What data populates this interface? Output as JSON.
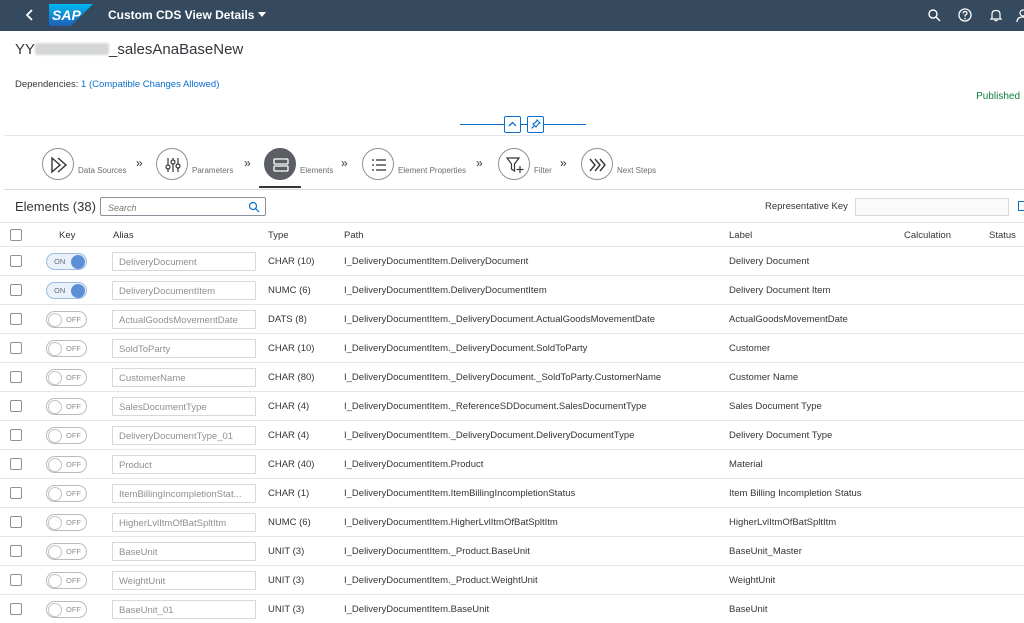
{
  "shell": {
    "title": "Custom CDS View Details",
    "logo_text": "SAP",
    "icons": [
      "back-icon",
      "search-icon",
      "help-icon",
      "notifications-icon",
      "user-menu-icon"
    ]
  },
  "header": {
    "object_title_prefix": "YY",
    "object_title_suffix": "_salesAnaBaseNew",
    "dependencies_label": "Dependencies:",
    "dependencies_link": "1 (Compatible Changes Allowed)",
    "status": "Published"
  },
  "wizard": {
    "active_step": 2,
    "steps": [
      {
        "label": "Data Sources",
        "icon": "data-sources-icon"
      },
      {
        "label": "Parameters",
        "icon": "parameters-icon"
      },
      {
        "label": "Elements",
        "icon": "elements-icon"
      },
      {
        "label": "Element Properties",
        "icon": "element-properties-icon"
      },
      {
        "label": "Filter",
        "icon": "filter-icon"
      },
      {
        "label": "Next Steps",
        "icon": "next-steps-icon"
      }
    ]
  },
  "toolbar": {
    "elements_count": "Elements (38)",
    "search_placeholder": "Search",
    "representative_key_label": "Representative Key",
    "representative_key_value": ""
  },
  "table": {
    "columns": {
      "key": "Key",
      "alias": "Alias",
      "type": "Type",
      "path": "Path",
      "label": "Label",
      "calculation": "Calculation",
      "status": "Status"
    },
    "toggle_on": "ON",
    "toggle_off": "OFF",
    "rows": [
      {
        "key": true,
        "alias": "DeliveryDocument",
        "type": "CHAR (10)",
        "path": "I_DeliveryDocumentItem.DeliveryDocument",
        "label": "Delivery Document"
      },
      {
        "key": true,
        "alias": "DeliveryDocumentItem",
        "type": "NUMC (6)",
        "path": "I_DeliveryDocumentItem.DeliveryDocumentItem",
        "label": "Delivery Document Item"
      },
      {
        "key": false,
        "alias": "ActualGoodsMovementDate",
        "type": "DATS (8)",
        "path": "I_DeliveryDocumentItem._DeliveryDocument.ActualGoodsMovementDate",
        "label": "ActualGoodsMovementDate"
      },
      {
        "key": false,
        "alias": "SoldToParty",
        "type": "CHAR (10)",
        "path": "I_DeliveryDocumentItem._DeliveryDocument.SoldToParty",
        "label": "Customer"
      },
      {
        "key": false,
        "alias": "CustomerName",
        "type": "CHAR (80)",
        "path": "I_DeliveryDocumentItem._DeliveryDocument._SoldToParty.CustomerName",
        "label": "Customer Name"
      },
      {
        "key": false,
        "alias": "SalesDocumentType",
        "type": "CHAR (4)",
        "path": "I_DeliveryDocumentItem._ReferenceSDDocument.SalesDocumentType",
        "label": "Sales Document Type"
      },
      {
        "key": false,
        "alias": "DeliveryDocumentType_01",
        "type": "CHAR (4)",
        "path": "I_DeliveryDocumentItem._DeliveryDocument.DeliveryDocumentType",
        "label": "Delivery Document Type"
      },
      {
        "key": false,
        "alias": "Product",
        "type": "CHAR (40)",
        "path": "I_DeliveryDocumentItem.Product",
        "label": "Material"
      },
      {
        "key": false,
        "alias": "ItemBillingIncompletionStat...",
        "type": "CHAR (1)",
        "path": "I_DeliveryDocumentItem.ItemBillingIncompletionStatus",
        "label": "Item Billing Incompletion Status"
      },
      {
        "key": false,
        "alias": "HigherLvlItmOfBatSpltItm",
        "type": "NUMC (6)",
        "path": "I_DeliveryDocumentItem.HigherLvlItmOfBatSpltItm",
        "label": "HigherLvlItmOfBatSpltItm"
      },
      {
        "key": false,
        "alias": "BaseUnit",
        "type": "UNIT (3)",
        "path": "I_DeliveryDocumentItem._Product.BaseUnit",
        "label": "BaseUnit_Master"
      },
      {
        "key": false,
        "alias": "WeightUnit",
        "type": "UNIT (3)",
        "path": "I_DeliveryDocumentItem._Product.WeightUnit",
        "label": "WeightUnit"
      },
      {
        "key": false,
        "alias": "BaseUnit_01",
        "type": "UNIT (3)",
        "path": "I_DeliveryDocumentItem.BaseUnit",
        "label": "BaseUnit"
      }
    ]
  }
}
